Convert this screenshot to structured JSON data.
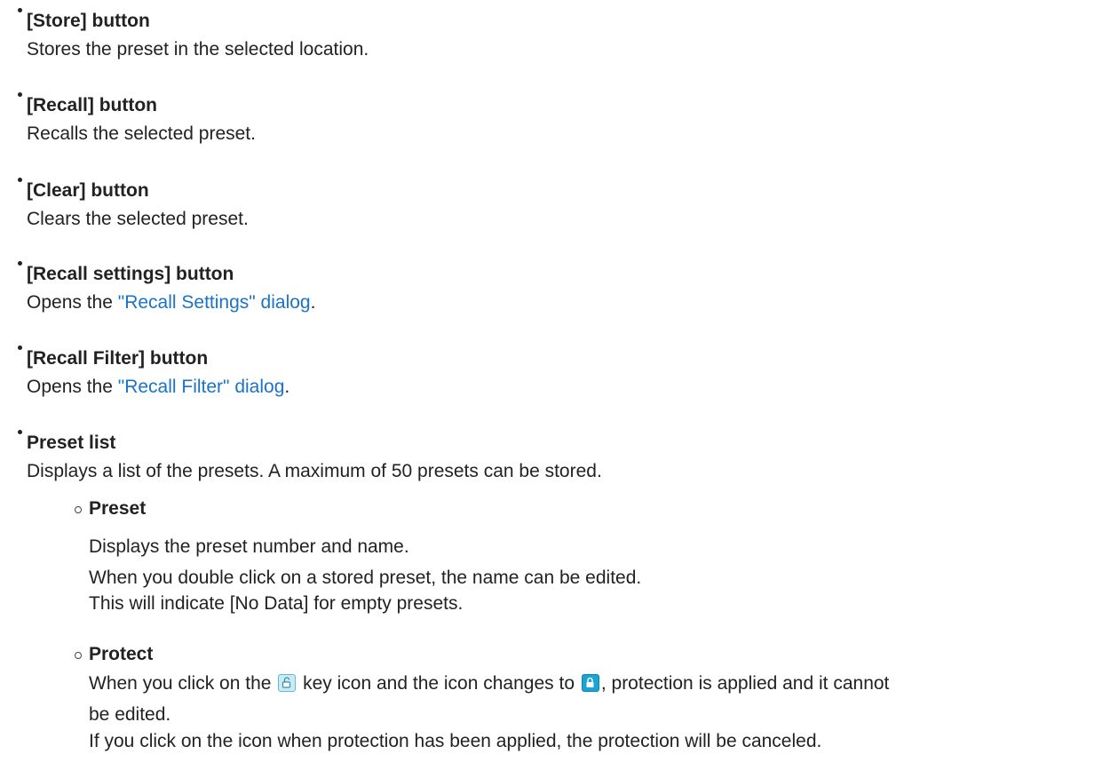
{
  "items": [
    {
      "title": "[Store] button",
      "desc": "Stores the preset in the selected location."
    },
    {
      "title": "[Recall] button",
      "desc": "Recalls the selected preset."
    },
    {
      "title": "[Clear] button",
      "desc": "Clears the selected preset."
    },
    {
      "title": "[Recall settings] button",
      "desc_prefix": "Opens the ",
      "link": "\"Recall Settings\" dialog",
      "desc_suffix": "."
    },
    {
      "title": "[Recall Filter] button",
      "desc_prefix": "Opens the ",
      "link": "\"Recall Filter\" dialog",
      "desc_suffix": "."
    },
    {
      "title": "Preset list",
      "desc": "Displays a list of the presets. A maximum of 50 presets can be stored."
    }
  ],
  "preset": {
    "title": "Preset",
    "line1": "Displays the preset number and name.",
    "line2": "When you double click on a stored preset, the name can be edited.",
    "line3": "This will indicate [No Data] for empty presets."
  },
  "protect": {
    "title": "Protect",
    "line1_a": "When you click on the",
    "line1_b": "key icon and the icon changes to",
    "line1_c": ", protection is applied and it cannot",
    "line2": "be edited.",
    "line3": "If you click on the icon when protection has been applied, the protection will be canceled.",
    "icon_open": "unlocked-key-icon",
    "icon_locked": "locked-key-icon"
  },
  "colors": {
    "link": "#1a73c8",
    "icon_open_bg": "#c7ecf7",
    "icon_locked_bg": "#1aa3d6"
  }
}
